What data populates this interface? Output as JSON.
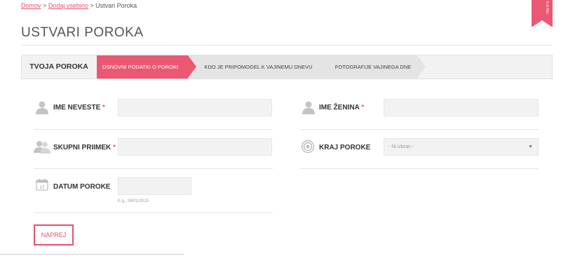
{
  "breadcrumb": {
    "items": [
      "Domov",
      "Dodaj vsebino",
      "Ustvari Poroka"
    ],
    "separator": ">"
  },
  "ribbon": {
    "text": "CENE"
  },
  "page": {
    "title": "USTVARI POROKA"
  },
  "stepper": {
    "label": "TVOJA POROKA",
    "steps": [
      {
        "label": "OSNOVNI PODATKI O POROKI",
        "active": true
      },
      {
        "label": "KDO JE PRIPOMOGEL K VAJINEMU DNEVU",
        "active": false
      },
      {
        "label": "FOTOGRAFIJE VAJINEGA DNE",
        "active": false
      }
    ]
  },
  "form": {
    "bride_name": {
      "label": "IME NEVESTE",
      "required_mark": "*",
      "value": "",
      "icon": "person-icon"
    },
    "groom_name": {
      "label": "IME ŽENINA",
      "required_mark": "*",
      "value": "",
      "icon": "person-icon"
    },
    "shared_surname": {
      "label": "SKUPNI PRIIMEK",
      "required_mark": "*",
      "value": "",
      "icon": "couple-icon"
    },
    "location": {
      "label": "KRAJ POROKE",
      "selected": "- Ni izbran -",
      "icon": "target-icon"
    },
    "date": {
      "label": "DATUM POROKE",
      "value": "",
      "hint": "E.g., 06/01/2015",
      "icon": "calendar-icon",
      "calendar_day": "17"
    }
  },
  "buttons": {
    "next_label": "NAPREJ"
  },
  "colors": {
    "accent": "#ea5873",
    "field_bg": "#f2f2f2",
    "step_bg": "#e4e4e4"
  }
}
